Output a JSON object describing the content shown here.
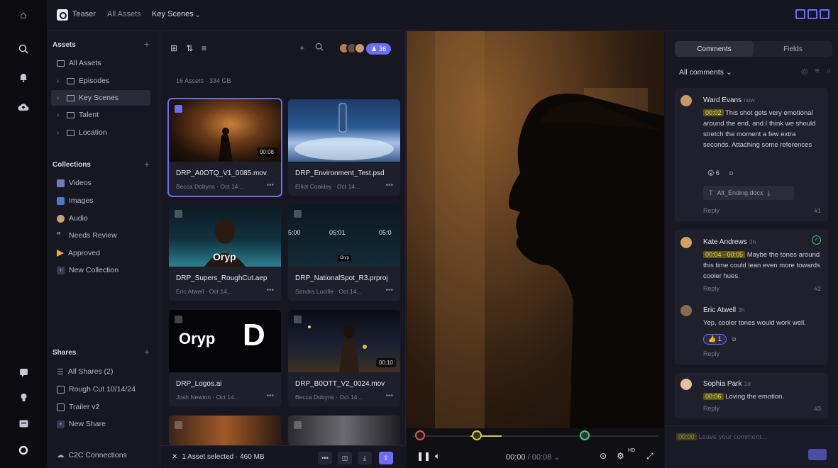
{
  "topbar": {
    "project": "Teaser",
    "breadcrumb_all": "All Assets",
    "breadcrumb_current": "Key Scenes"
  },
  "sidebar": {
    "assets_title": "Assets",
    "assets": [
      {
        "label": "All Assets"
      },
      {
        "label": "Episodes"
      },
      {
        "label": "Key Scenes"
      },
      {
        "label": "Talent"
      },
      {
        "label": "Location"
      }
    ],
    "collections_title": "Collections",
    "collections": [
      {
        "label": "Videos",
        "color": "#6b7dbd"
      },
      {
        "label": "Images",
        "color": "#4d7ac4"
      },
      {
        "label": "Audio",
        "color": "#c9a36b"
      },
      {
        "label": "Needs Review",
        "color": "#d6d6e0"
      },
      {
        "label": "Approved",
        "color": "#f0a640"
      },
      {
        "label": "New Collection",
        "color": "#3a3a4a"
      }
    ],
    "shares_title": "Shares",
    "shares": [
      {
        "label": "All Shares (2)"
      },
      {
        "label": "Rough Cut 10/14/24"
      },
      {
        "label": "Trailer v2"
      },
      {
        "label": "New Share"
      }
    ],
    "c2c": "C2C Connections"
  },
  "grid": {
    "count": "16 Assets · 334 GB",
    "user_count": "36",
    "footer_selected": "1 Asset selected · 460 MB",
    "cards": [
      {
        "name": "DRP_A0OTQ_V1_0085.mov",
        "meta": "Becca Dobyns · Oct 14...",
        "duration": "00:08",
        "selected": true
      },
      {
        "name": "DRP_Environment_Test.psd",
        "meta": "Elliot Coakley · Oct 14...",
        "duration": "",
        "selected": false
      },
      {
        "name": "DRP_Supers_RoughCut.aep",
        "meta": "Eric Atwell · Oct 14...",
        "duration": "",
        "selected": false
      },
      {
        "name": "DRP_NationalSpot_R3.prproj",
        "meta": "Sandra Lucille · Oct 14...",
        "duration": "",
        "selected": false
      },
      {
        "name": "DRP_Logos.ai",
        "meta": "Josh Newton · Oct 14...",
        "duration": "",
        "selected": false
      },
      {
        "name": "DRP_B0OTT_V2_0024.mov",
        "meta": "Becca Dobyns · Oct 14...",
        "duration": "00:10",
        "selected": false
      }
    ],
    "thumb_texts": {
      "brand": "Oryp",
      "brand_small": "Oryp",
      "logo_word": "Oryp",
      "logo_letter": "D",
      "tc1": "5:00",
      "tc2": "05:01",
      "tc3": "05:0"
    }
  },
  "player": {
    "current": "00:00",
    "total": "/ 00:08",
    "hd": "HD"
  },
  "comments": {
    "tab_comments": "Comments",
    "tab_fields": "Fields",
    "filter": "All comments",
    "items": [
      {
        "author": "Ward Evans",
        "time": "now",
        "timestamp": "00:02",
        "text": "This shot gets very emotional around the end, and I think we should stretch the moment a few extra seconds. Attaching some references",
        "reaction_count": "6",
        "attachment": "Alt_Ending.docx",
        "reply": "Reply",
        "number": "#1"
      },
      {
        "author": "Kate Andrews",
        "time": "3h",
        "timestamp": "00:04 - 00:05",
        "text": "Maybe the tones around this time could lean even more towards cooler hues.",
        "reply": "Reply",
        "number": "#2"
      },
      {
        "author": "Eric Atwell",
        "time": "3h",
        "text": "Yep, cooler tones would work well.",
        "reaction_count": "1",
        "reply": "Reply"
      },
      {
        "author": "Sophia Park",
        "time": "1d",
        "timestamp": "00:06",
        "text": "Loving the emotion.",
        "reply": "Reply",
        "number": "#3"
      }
    ],
    "composer_timestamp": "00:00",
    "composer_placeholder": "Leave your comment..."
  }
}
